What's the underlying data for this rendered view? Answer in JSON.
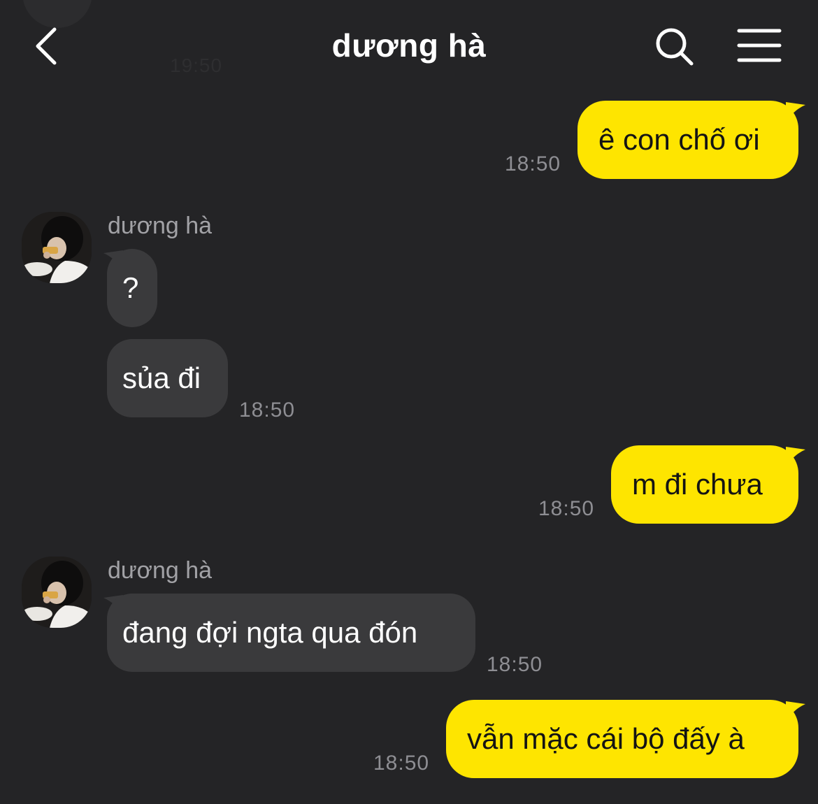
{
  "header": {
    "title": "dương hà",
    "back_icon": "chevron-left-icon",
    "search_icon": "search-icon",
    "menu_icon": "hamburger-menu-icon"
  },
  "ghost": {
    "time": "19:50"
  },
  "colors": {
    "background": "#242426",
    "outgoing_bubble": "#fee500",
    "incoming_bubble": "#3a3a3c",
    "timestamp": "#8e8e93"
  },
  "messages": [
    {
      "side": "out",
      "text": "ê con chố ơi",
      "time": "18:50"
    },
    {
      "side": "in",
      "sender": "dương hà",
      "text": "?"
    },
    {
      "side": "in",
      "text": "sủa đi",
      "time": "18:50"
    },
    {
      "side": "out",
      "text": "m đi chưa",
      "time": "18:50"
    },
    {
      "side": "in",
      "sender": "dương hà",
      "text": "đang đợi ngta qua đón",
      "time": "18:50"
    },
    {
      "side": "out",
      "text": "vẫn mặc cái bộ đấy à",
      "time": "18:50"
    }
  ]
}
